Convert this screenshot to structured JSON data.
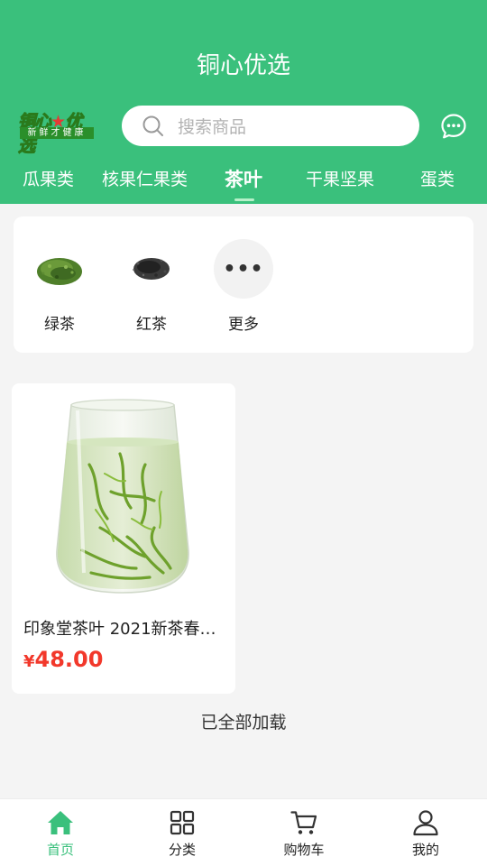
{
  "header": {
    "title": "铜心优选",
    "logo_main": "铜心优选",
    "logo_tagline": "新鲜才健康",
    "search_placeholder": "搜索商品",
    "chat_icon": "chat-bubble-icon"
  },
  "tabs": [
    {
      "label": "瓜果类",
      "active": false
    },
    {
      "label": "核果仁果类",
      "active": false
    },
    {
      "label": "茶叶",
      "active": true
    },
    {
      "label": "干果坚果",
      "active": false
    },
    {
      "label": "蛋类",
      "active": false
    }
  ],
  "subcategories": [
    {
      "label": "绿茶",
      "icon": "green-tea-leaves-icon"
    },
    {
      "label": "红茶",
      "icon": "black-tea-leaves-icon"
    },
    {
      "label": "更多",
      "icon": "more-dots-icon",
      "glyph": "•••"
    }
  ],
  "products": [
    {
      "title": "印象堂茶叶 2021新茶春…",
      "currency": "¥",
      "price": "48.00"
    }
  ],
  "list_status": "已全部加载",
  "bottom_nav": [
    {
      "label": "首页",
      "icon": "home-icon",
      "active": true
    },
    {
      "label": "分类",
      "icon": "grid-icon",
      "active": false
    },
    {
      "label": "购物车",
      "icon": "cart-icon",
      "active": false
    },
    {
      "label": "我的",
      "icon": "user-icon",
      "active": false
    }
  ],
  "colors": {
    "brand_green": "#3ac07c",
    "price_red": "#f2382b",
    "page_bg": "#f4f4f4"
  }
}
